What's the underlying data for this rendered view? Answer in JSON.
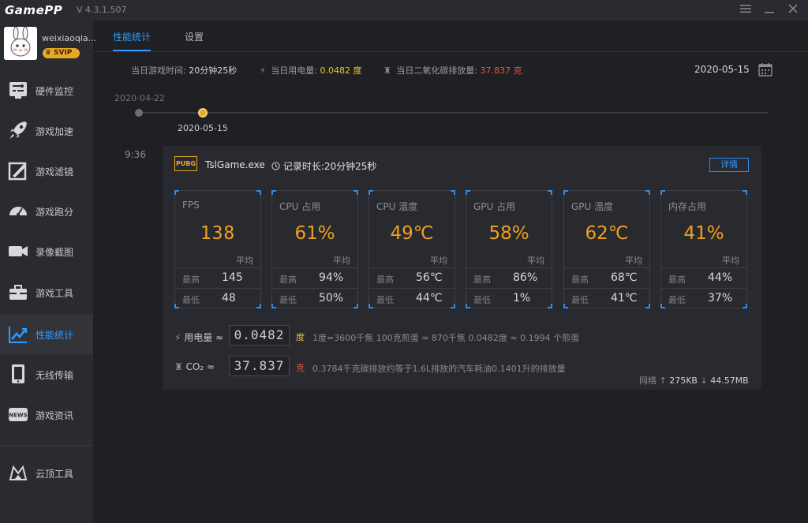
{
  "app": {
    "logo": "GamePP",
    "version": "V 4.3.1.507"
  },
  "window_controls": [
    "menu-icon",
    "minimize-icon",
    "close-icon"
  ],
  "user": {
    "name": "weixiaoqia...",
    "badge": "SVIP"
  },
  "sidebar": {
    "items": [
      {
        "label": "硬件监控",
        "icon": "hardware-monitor-icon"
      },
      {
        "label": "游戏加速",
        "icon": "rocket-icon"
      },
      {
        "label": "游戏滤镜",
        "icon": "filter-icon"
      },
      {
        "label": "游戏跑分",
        "icon": "speedometer-icon"
      },
      {
        "label": "录像截图",
        "icon": "camera-icon"
      },
      {
        "label": "游戏工具",
        "icon": "toolbox-icon"
      },
      {
        "label": "性能统计",
        "icon": "chart-icon",
        "active": true
      },
      {
        "label": "无线传输",
        "icon": "phone-icon"
      },
      {
        "label": "游戏资讯",
        "icon": "news-icon"
      }
    ],
    "bottom_item": {
      "label": "云顶工具",
      "icon": "crown-tool-icon"
    }
  },
  "tabs": [
    {
      "label": "性能统计",
      "active": true
    },
    {
      "label": "设置",
      "active": false
    }
  ],
  "summary": {
    "play_time_label": "当日游戏时间:",
    "play_time_value": "20分钟25秒",
    "power_label": "当日用电量:",
    "power_value": "0.0482 度",
    "co2_label": "当日二氧化碳排放量:",
    "co2_value": "37.837 克"
  },
  "selected_date": "2020-05-15",
  "timeline": {
    "start_date": "2020-04-22",
    "active_date": "2020-05-15"
  },
  "session": {
    "time": "9:36",
    "game_icon_text": "PUBG",
    "game_name": "TslGame.exe",
    "record_label": "记录时长:20分钟25秒",
    "detail_button": "详情",
    "avg_label": "平均",
    "max_label": "最高",
    "min_label": "最低",
    "metrics": [
      {
        "name": "FPS",
        "avg": "138",
        "max": "145",
        "min": "48"
      },
      {
        "name": "CPU 占用",
        "avg": "61%",
        "max": "94%",
        "min": "50%"
      },
      {
        "name": "CPU 温度",
        "avg": "49℃",
        "max": "56℃",
        "min": "44℃"
      },
      {
        "name": "GPU 占用",
        "avg": "58%",
        "max": "86%",
        "min": "1%"
      },
      {
        "name": "GPU 温度",
        "avg": "62℃",
        "max": "68℃",
        "min": "41℃"
      },
      {
        "name": "内存占用",
        "avg": "41%",
        "max": "44%",
        "min": "37%"
      }
    ],
    "energy": {
      "label": "用电量 ≈",
      "value": "0.0482",
      "unit": "度",
      "desc": "1度=3600千焦    100克煎蛋 ≈ 870千焦    0.0482度 ≈ 0.1994 个煎蛋",
      "unit_color": "#e8c433"
    },
    "co2": {
      "label": "CO₂ ≈",
      "value": "37.837",
      "unit": "克",
      "desc": "0.3784千克碳排放约等于1.6L排放的汽车耗油0.1401升的排放量",
      "unit_color": "#e05a3a"
    },
    "network": {
      "label": "网络",
      "up": "275KB",
      "down": "44.57MB"
    }
  }
}
